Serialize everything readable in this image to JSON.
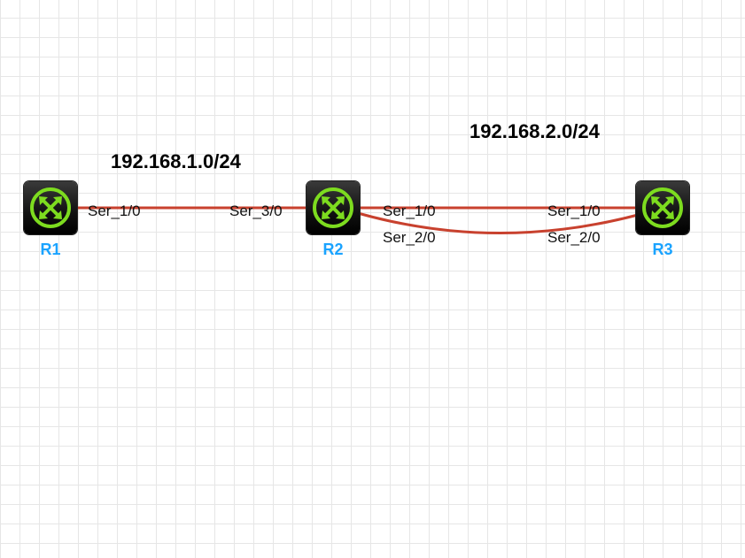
{
  "networks": [
    {
      "id": "net1",
      "label": "192.168.1.0/24"
    },
    {
      "id": "net2",
      "label": "192.168.2.0/24"
    }
  ],
  "routers": [
    {
      "id": "r1",
      "name": "R1",
      "icon": "router-icon"
    },
    {
      "id": "r2",
      "name": "R2",
      "icon": "router-icon"
    },
    {
      "id": "r3",
      "name": "R3",
      "icon": "router-icon"
    }
  ],
  "links": [
    {
      "from": "R1",
      "from_port": "Ser_1/0",
      "to": "R2",
      "to_port": "Ser_3/0"
    },
    {
      "from": "R2",
      "from_port": "Ser_1/0",
      "to": "R3",
      "to_port": "Ser_1/0"
    },
    {
      "from": "R2",
      "from_port": "Ser_2/0",
      "to": "R3",
      "to_port": "Ser_2/0"
    }
  ],
  "colors": {
    "link": "#c8412e",
    "router_label": "#1aa3ff",
    "router_icon": "#7ddc1f",
    "grid": "#e6e6e6"
  }
}
